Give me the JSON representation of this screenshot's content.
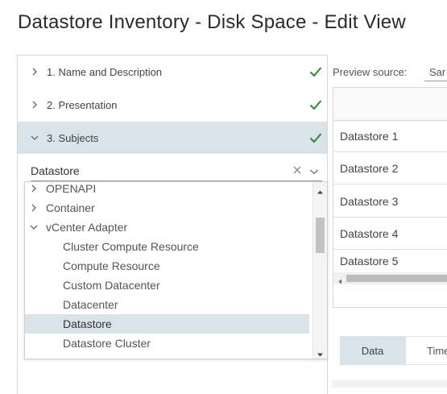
{
  "page": {
    "title": "Datastore Inventory - Disk Space - Edit View"
  },
  "wizard": {
    "steps": [
      {
        "label": "1. Name and Description",
        "state": "collapsed",
        "complete": true
      },
      {
        "label": "2. Presentation",
        "state": "collapsed",
        "complete": true
      },
      {
        "label": "3. Subjects",
        "state": "expanded",
        "complete": true
      }
    ],
    "subject_combo": {
      "value": "Datastore"
    },
    "dropdown": {
      "items": [
        {
          "label": "OPENAPI",
          "type": "group",
          "expanded": false
        },
        {
          "label": "Container",
          "type": "group",
          "expanded": false
        },
        {
          "label": "vCenter Adapter",
          "type": "group",
          "expanded": true
        },
        {
          "label": "Cluster Compute Resource",
          "type": "child"
        },
        {
          "label": "Compute Resource",
          "type": "child"
        },
        {
          "label": "Custom Datacenter",
          "type": "child"
        },
        {
          "label": "Datacenter",
          "type": "child"
        },
        {
          "label": "Datastore",
          "type": "child",
          "selected": true
        },
        {
          "label": "Datastore Cluster",
          "type": "child"
        }
      ]
    }
  },
  "preview": {
    "source_label": "Preview source:",
    "source_value": "Sar",
    "rows": [
      "Datastore 1",
      "Datastore 2",
      "Datastore 3",
      "Datastore 4",
      "Datastore 5"
    ],
    "tabs": [
      {
        "label": "Data",
        "active": true
      },
      {
        "label": "Time",
        "active": false
      }
    ]
  },
  "colors": {
    "active_bg": "#d8e3ea",
    "check_green": "#2e8b2e",
    "border": "#d8d8d8"
  }
}
